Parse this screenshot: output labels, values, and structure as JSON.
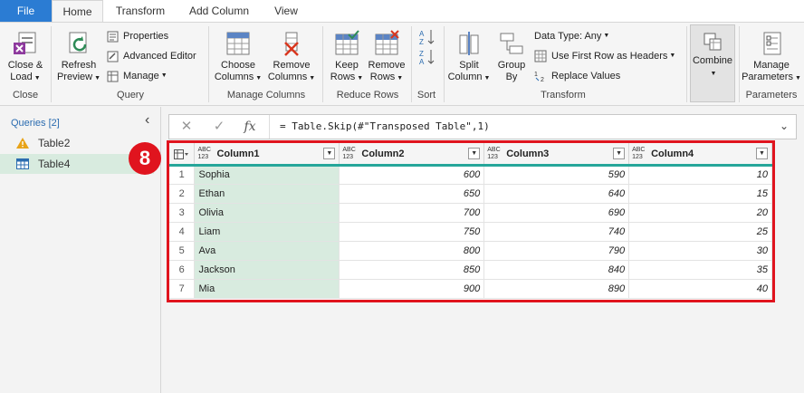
{
  "menu": {
    "file": "File",
    "home": "Home",
    "transform": "Transform",
    "add_column": "Add Column",
    "view": "View"
  },
  "ribbon": {
    "close_load": "Close &",
    "close_load2": "Load",
    "close_group": "Close",
    "refresh": "Refresh",
    "refresh2": "Preview",
    "properties": "Properties",
    "advanced_editor": "Advanced Editor",
    "manage": "Manage",
    "query_group": "Query",
    "choose_columns": "Choose",
    "choose_columns2": "Columns",
    "remove_columns": "Remove",
    "remove_columns2": "Columns",
    "manage_columns_group": "Manage Columns",
    "keep_rows": "Keep",
    "keep_rows2": "Rows",
    "remove_rows": "Remove",
    "remove_rows2": "Rows",
    "reduce_rows_group": "Reduce Rows",
    "sort_group": "Sort",
    "split_column": "Split",
    "split_column2": "Column",
    "group_by": "Group",
    "group_by2": "By",
    "data_type": "Data Type: Any",
    "first_row_headers": "Use First Row as Headers",
    "replace_values": "Replace Values",
    "transform_group": "Transform",
    "combine": "Combine",
    "manage_params": "Manage",
    "manage_params2": "Parameters",
    "parameters_group": "Parameters"
  },
  "queries": {
    "header": "Queries [2]",
    "items": [
      "Table2",
      "Table4"
    ]
  },
  "formula": {
    "text": "= Table.Skip(#\"Transposed Table\",1)"
  },
  "badge": "8",
  "table": {
    "type_tag": "ABC\n123",
    "columns": [
      "Column1",
      "Column2",
      "Column3",
      "Column4"
    ],
    "rows": [
      [
        "1",
        "Sophia",
        "600",
        "590",
        "10"
      ],
      [
        "2",
        "Ethan",
        "650",
        "640",
        "15"
      ],
      [
        "3",
        "Olivia",
        "700",
        "690",
        "20"
      ],
      [
        "4",
        "Liam",
        "750",
        "740",
        "25"
      ],
      [
        "5",
        "Ava",
        "800",
        "790",
        "30"
      ],
      [
        "6",
        "Jackson",
        "850",
        "840",
        "35"
      ],
      [
        "7",
        "Mia",
        "900",
        "890",
        "40"
      ]
    ]
  },
  "colors": {
    "file_tab": "#2b7cd3",
    "highlight_border": "#e0141e",
    "header_underline": "#26a69a",
    "selected_column": "#d8ebdf"
  }
}
